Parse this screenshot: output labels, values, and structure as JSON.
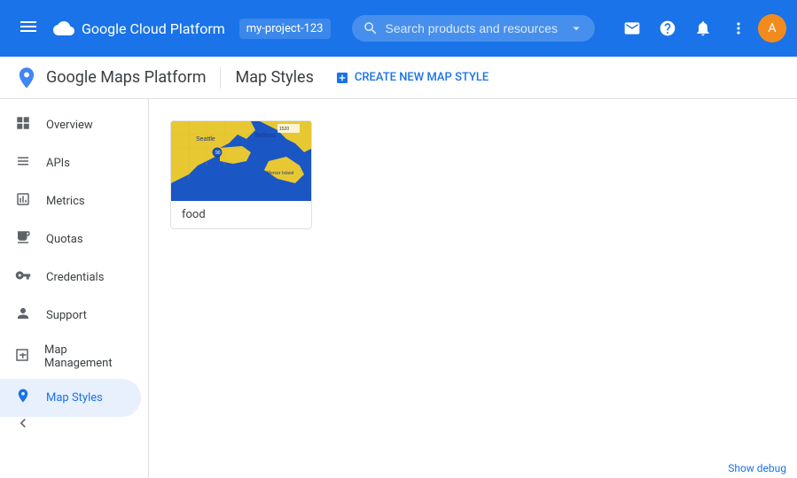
{
  "topbar": {
    "title": "Google Cloud Platform",
    "project": "my-project-123",
    "search_placeholder": "Search products and resources",
    "menu_icon": "☰"
  },
  "subbar": {
    "app_title": "Google Maps Platform",
    "page_title": "Map Styles",
    "create_btn_label": "CREATE NEW MAP STYLE"
  },
  "sidebar": {
    "items": [
      {
        "id": "overview",
        "label": "Overview",
        "icon": "⊞"
      },
      {
        "id": "apis",
        "label": "APIs",
        "icon": "≡"
      },
      {
        "id": "metrics",
        "label": "Metrics",
        "icon": "↑"
      },
      {
        "id": "quotas",
        "label": "Quotas",
        "icon": "▭"
      },
      {
        "id": "credentials",
        "label": "Credentials",
        "icon": "⚷"
      },
      {
        "id": "support",
        "label": "Support",
        "icon": "👤"
      },
      {
        "id": "map-management",
        "label": "Map Management",
        "icon": "▦"
      },
      {
        "id": "map-styles",
        "label": "Map Styles",
        "icon": "◎"
      }
    ]
  },
  "map_styles": {
    "cards": [
      {
        "id": "food",
        "label": "food"
      }
    ]
  },
  "debug_bar": {
    "label": "Show debug"
  }
}
